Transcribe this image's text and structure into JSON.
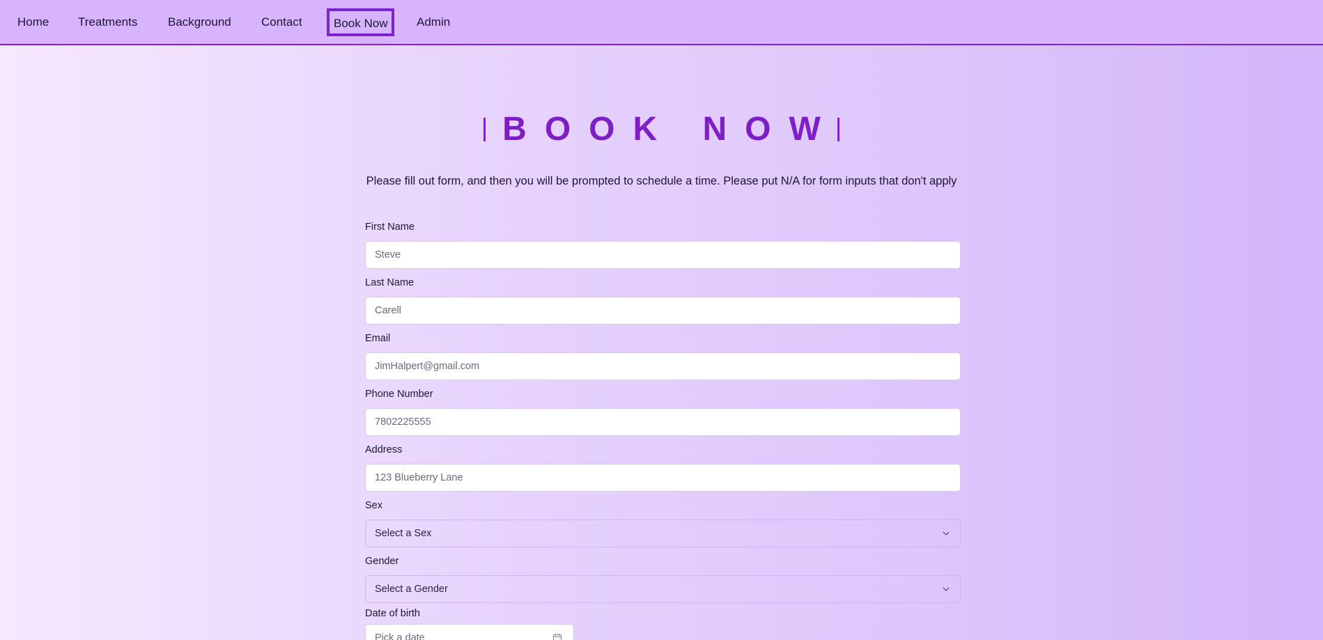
{
  "nav": {
    "items": [
      {
        "label": "Home"
      },
      {
        "label": "Treatments"
      },
      {
        "label": "Background"
      },
      {
        "label": "Contact"
      },
      {
        "label": "Book Now",
        "active": true
      },
      {
        "label": "Admin"
      }
    ]
  },
  "page": {
    "title": "BOOK NOW",
    "subtitle": "Please fill out form, and then you will be prompted to schedule a time. Please put N/A for form inputs that don't apply"
  },
  "form": {
    "first_name": {
      "label": "First Name",
      "placeholder": "Steve"
    },
    "last_name": {
      "label": "Last Name",
      "placeholder": "Carell"
    },
    "email": {
      "label": "Email",
      "placeholder": "JimHalpert@gmail.com"
    },
    "phone": {
      "label": "Phone Number",
      "placeholder": "7802225555"
    },
    "address": {
      "label": "Address",
      "placeholder": "123 Blueberry Lane"
    },
    "sex": {
      "label": "Sex",
      "selected": "Select a Sex"
    },
    "gender": {
      "label": "Gender",
      "selected": "Select a Gender"
    },
    "dob": {
      "label": "Date of birth",
      "placeholder": "Pick a date"
    }
  },
  "icons": {
    "select_chevron": "chevron-down-icon",
    "date_picker": "calendar-icon"
  },
  "colors": {
    "accent": "#7e22ce",
    "nav_background": "#d8b4fe",
    "title": "#7e1fc6"
  }
}
